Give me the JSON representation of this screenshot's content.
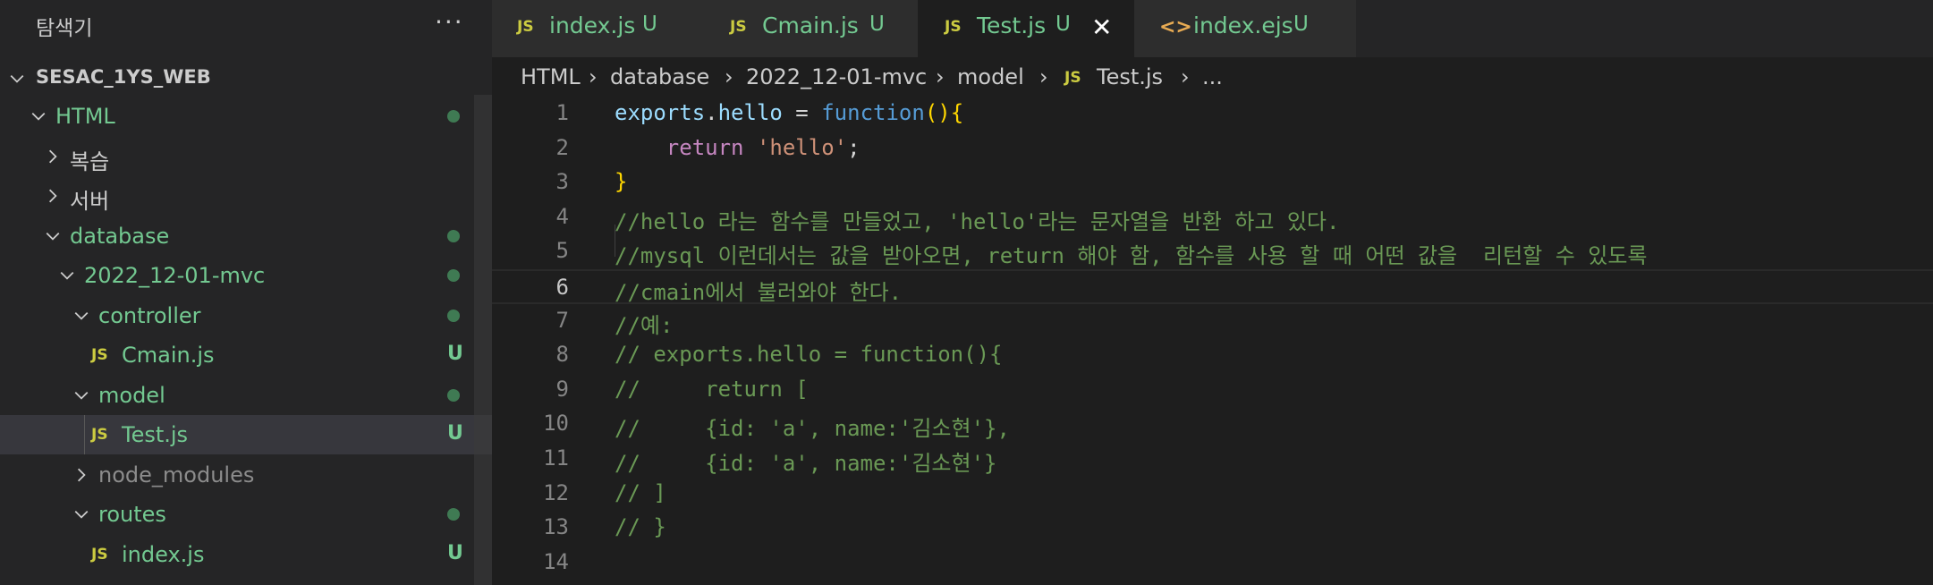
{
  "sidebar": {
    "title": "탐색기",
    "more": "···",
    "root": "SESAC_1YS_WEB",
    "tree": [
      {
        "label": "HTML",
        "kind": "folder",
        "state": "modified",
        "marker": "dot"
      },
      {
        "label": "복습",
        "kind": "folder",
        "state": "normal",
        "marker": ""
      },
      {
        "label": "서버",
        "kind": "folder",
        "state": "normal",
        "marker": ""
      },
      {
        "label": "database",
        "kind": "folder",
        "state": "modified",
        "marker": "dot"
      },
      {
        "label": "2022_12-01-mvc",
        "kind": "folder",
        "state": "modified",
        "marker": "dot"
      },
      {
        "label": "controller",
        "kind": "folder",
        "state": "modified",
        "marker": "dot"
      },
      {
        "label": "Cmain.js",
        "kind": "js",
        "file_icon": "JS",
        "state": "untracked",
        "marker": "U"
      },
      {
        "label": "model",
        "kind": "folder",
        "state": "modified",
        "marker": "dot"
      },
      {
        "label": "Test.js",
        "kind": "js",
        "file_icon": "JS",
        "state": "untracked",
        "marker": "U"
      },
      {
        "label": "node_modules",
        "kind": "folder",
        "state": "ignored",
        "marker": ""
      },
      {
        "label": "routes",
        "kind": "folder",
        "state": "modified",
        "marker": "dot"
      },
      {
        "label": "index.js",
        "kind": "js",
        "file_icon": "JS",
        "state": "untracked",
        "marker": "U"
      }
    ]
  },
  "tabs": [
    {
      "icon": "JS",
      "label": "index.js",
      "badge": "U"
    },
    {
      "icon": "JS",
      "label": "Cmain.js",
      "badge": "U"
    },
    {
      "icon": "JS",
      "label": "Test.js",
      "badge": "U",
      "close": "✕"
    },
    {
      "icon": "<>",
      "label": "index.ejs",
      "badge": "U"
    }
  ],
  "breadcrumb": {
    "items": [
      "HTML",
      "database",
      "2022_12-01-mvc",
      "model"
    ],
    "file_icon": "JS",
    "file": "Test.js",
    "tail": "..."
  },
  "editor": {
    "current_line": 6,
    "lines": [
      {
        "n": "1",
        "tokens": [
          [
            "var",
            "exports"
          ],
          [
            "op",
            "."
          ],
          [
            "var",
            "hello"
          ],
          [
            "op",
            " = "
          ],
          [
            "kw",
            "function"
          ],
          [
            "brace",
            "()"
          ],
          [
            "brace",
            "{"
          ]
        ]
      },
      {
        "n": "2",
        "tokens": [
          [
            "op",
            "    "
          ],
          [
            "ret",
            "return"
          ],
          [
            "op",
            " "
          ],
          [
            "str",
            "'hello'"
          ],
          [
            "op",
            ";"
          ]
        ]
      },
      {
        "n": "3",
        "tokens": [
          [
            "brace",
            "}"
          ]
        ]
      },
      {
        "n": "4",
        "tokens": [
          [
            "com",
            "//hello 라는 함수를 만들었고, 'hello'라는 문자열을 반환 하고 있다."
          ]
        ]
      },
      {
        "n": "5",
        "tokens": [
          [
            "com",
            "//mysql 이런데서는 값을 받아오면, return 해야 함, 함수를 사용 할 때 어떤 값을  리턴할 수 있도록"
          ]
        ]
      },
      {
        "n": "6",
        "tokens": [
          [
            "com",
            "//cmain에서 불러와야 한다."
          ]
        ]
      },
      {
        "n": "7",
        "tokens": [
          [
            "com",
            "//예:"
          ]
        ]
      },
      {
        "n": "8",
        "tokens": [
          [
            "com",
            "// exports.hello = function(){"
          ]
        ]
      },
      {
        "n": "9",
        "tokens": [
          [
            "com",
            "//     return ["
          ]
        ]
      },
      {
        "n": "10",
        "tokens": [
          [
            "com",
            "//     {id: 'a', name:'김소현'},"
          ]
        ]
      },
      {
        "n": "11",
        "tokens": [
          [
            "com",
            "//     {id: 'a', name:'김소현'}"
          ]
        ]
      },
      {
        "n": "12",
        "tokens": [
          [
            "com",
            "// ]"
          ]
        ]
      },
      {
        "n": "13",
        "tokens": [
          [
            "com",
            "// }"
          ]
        ]
      },
      {
        "n": "14",
        "tokens": []
      }
    ]
  },
  "colors": {
    "accent_untracked": "#73c991",
    "js_icon": "#cbcb41",
    "comment": "#6a9955"
  }
}
